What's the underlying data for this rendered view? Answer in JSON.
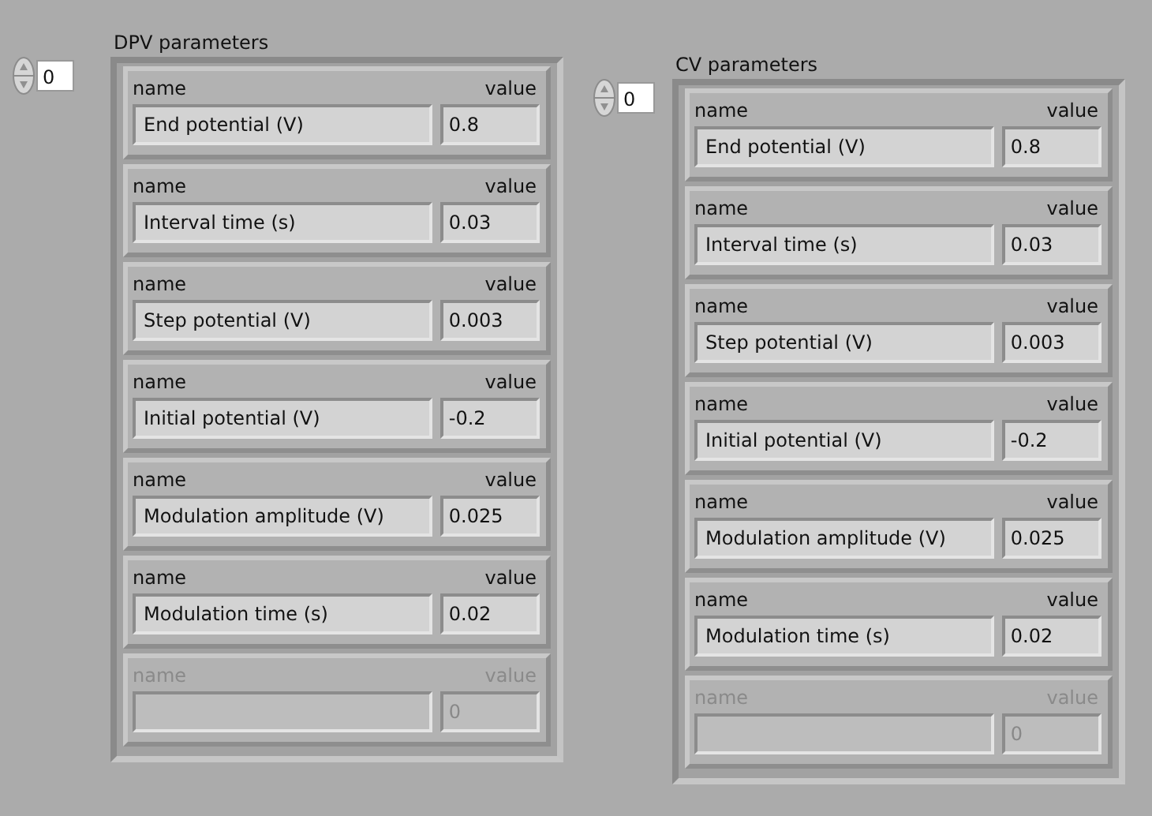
{
  "panels": [
    {
      "label": "DPV parameters",
      "index": "0",
      "elements": [
        {
          "name_label": "name",
          "value_label": "value",
          "name": "End potential (V)",
          "value": "0.8",
          "disabled": false
        },
        {
          "name_label": "name",
          "value_label": "value",
          "name": "Interval time (s)",
          "value": "0.03",
          "disabled": false
        },
        {
          "name_label": "name",
          "value_label": "value",
          "name": "Step potential (V)",
          "value": "0.003",
          "disabled": false
        },
        {
          "name_label": "name",
          "value_label": "value",
          "name": "Initial potential (V)",
          "value": "-0.2",
          "disabled": false
        },
        {
          "name_label": "name",
          "value_label": "value",
          "name": "Modulation amplitude (V)",
          "value": "0.025",
          "disabled": false
        },
        {
          "name_label": "name",
          "value_label": "value",
          "name": "Modulation time (s)",
          "value": "0.02",
          "disabled": false
        },
        {
          "name_label": "name",
          "value_label": "value",
          "value": "0",
          "disabled": true
        }
      ]
    },
    {
      "label": "CV parameters",
      "index": "0",
      "elements": [
        {
          "name_label": "name",
          "value_label": "value",
          "name": "End potential (V)",
          "value": "0.8",
          "disabled": false
        },
        {
          "name_label": "name",
          "value_label": "value",
          "name": "Interval time (s)",
          "value": "0.03",
          "disabled": false
        },
        {
          "name_label": "name",
          "value_label": "value",
          "name": "Step potential (V)",
          "value": "0.003",
          "disabled": false
        },
        {
          "name_label": "name",
          "value_label": "value",
          "name": "Initial potential (V)",
          "value": "-0.2",
          "disabled": false
        },
        {
          "name_label": "name",
          "value_label": "value",
          "name": "Modulation amplitude (V)",
          "value": "0.025",
          "disabled": false
        },
        {
          "name_label": "name",
          "value_label": "value",
          "name": "Modulation time (s)",
          "value": "0.02",
          "disabled": false
        },
        {
          "name_label": "name",
          "value_label": "value",
          "value": "0",
          "disabled": true
        }
      ]
    }
  ]
}
